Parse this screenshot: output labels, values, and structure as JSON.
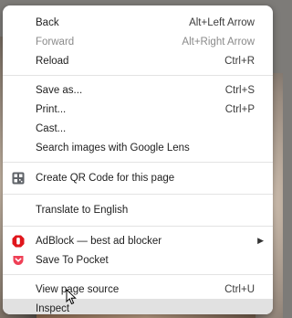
{
  "menu": {
    "groups": [
      [
        {
          "label": "Back",
          "shortcut": "Alt+Left Arrow"
        },
        {
          "label": "Forward",
          "shortcut": "Alt+Right Arrow"
        },
        {
          "label": "Reload",
          "shortcut": "Ctrl+R"
        }
      ],
      [
        {
          "label": "Save as...",
          "shortcut": "Ctrl+S"
        },
        {
          "label": "Print...",
          "shortcut": "Ctrl+P"
        },
        {
          "label": "Cast...",
          "shortcut": ""
        },
        {
          "label": "Search images with Google Lens",
          "shortcut": ""
        }
      ],
      [
        {
          "label": "Create QR Code for this page",
          "shortcut": "",
          "icon": "qr-code-icon"
        }
      ],
      [
        {
          "label": "Translate to English",
          "shortcut": ""
        }
      ],
      [
        {
          "label": "AdBlock — best ad blocker",
          "shortcut": "",
          "icon": "adblock-icon",
          "submenu_arrow": "▶"
        },
        {
          "label": "Save To Pocket",
          "shortcut": "",
          "icon": "pocket-icon"
        }
      ],
      [
        {
          "label": "View page source",
          "shortcut": "Ctrl+U"
        },
        {
          "label": "Inspect",
          "shortcut": "",
          "hovered": true
        }
      ]
    ]
  },
  "colors": {
    "menu_bg": "#ffffff",
    "hover_bg": "#e1e1e1",
    "adblock_red": "#e0161c",
    "pocket_red": "#ef4056"
  }
}
